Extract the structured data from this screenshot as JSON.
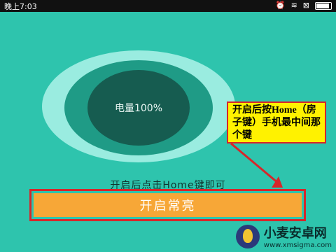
{
  "status": {
    "time": "晚上7:03",
    "icons": [
      "alarm-icon",
      "wifi-icon",
      "no-sim-icon",
      "battery-icon"
    ]
  },
  "battery": {
    "label": "电量100%"
  },
  "instruction": {
    "text": "开启后点击Home键即可"
  },
  "action": {
    "button_label": "开启常亮"
  },
  "annotation": {
    "text": "开启后按Home（房子键）手机最中间那个键"
  },
  "watermark": {
    "site_name": "小麦安卓网",
    "url": "www.xmsigma.com"
  },
  "colors": {
    "background": "#2ec4ad",
    "button": "#f7a737",
    "callout": "#fff200",
    "highlight": "#d6262a"
  }
}
